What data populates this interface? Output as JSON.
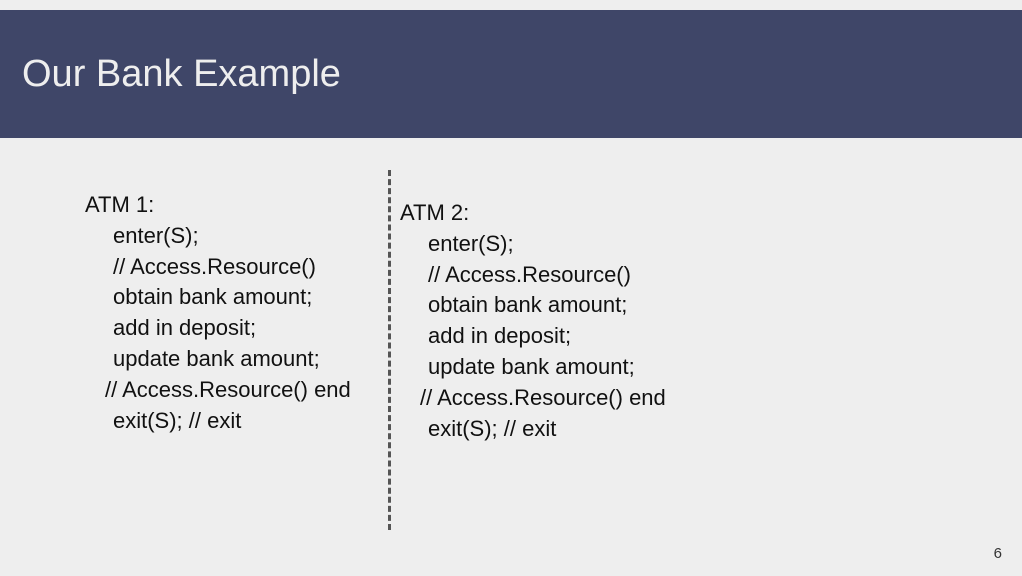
{
  "title": "Our Bank Example",
  "atm1": {
    "label": "ATM 1:",
    "lines": {
      "l1": "enter(S);",
      "l2": "// Access.Resource()",
      "l3": "obtain bank amount;",
      "l4": "add in deposit;",
      "l5": "update bank amount;",
      "l6": "// Access.Resource() end",
      "l7": "exit(S); // exit"
    }
  },
  "atm2": {
    "label": "ATM 2:",
    "lines": {
      "l1": "enter(S);",
      "l2": "// Access.Resource()",
      "l3": "obtain bank amount;",
      "l4": "add in deposit;",
      "l5": "update bank amount;",
      "l6": "// Access.Resource() end",
      "l7": "exit(S); // exit"
    }
  },
  "page_number": "6"
}
